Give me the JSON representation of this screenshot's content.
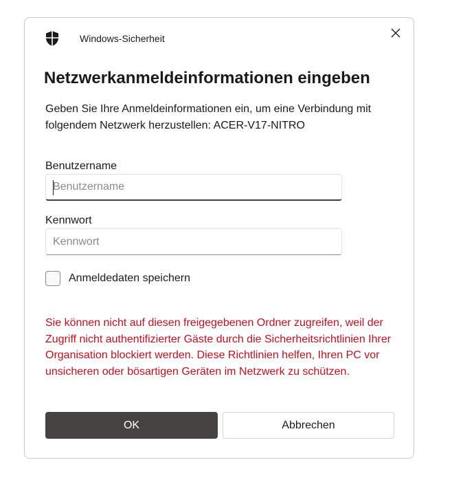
{
  "titlebar": {
    "title": "Windows-Sicherheit",
    "icon": "shield-icon",
    "close_icon": "close-icon"
  },
  "dialog": {
    "heading": "Netzwerkanmeldeinformationen eingeben",
    "description": "Geben Sie Ihre Anmeldeinformationen ein, um eine Verbindung mit folgendem Netzwerk herzustellen: ACER-V17-NITRO"
  },
  "form": {
    "username": {
      "label": "Benutzername",
      "value": "",
      "placeholder": "Benutzername"
    },
    "password": {
      "label": "Kennwort",
      "value": "",
      "placeholder": "Kennwort"
    },
    "remember": {
      "label": "Anmeldedaten speichern",
      "checked": false
    }
  },
  "error": {
    "message": "Sie können nicht auf diesen freigegebenen Ordner zugreifen, weil der Zugriff nicht authentifizierter Gäste durch die Sicherheitsrichtlinien Ihrer Organisation blockiert werden. Diese Richtlinien helfen, Ihren PC vor unsicheren oder bösartigen Geräten im Netzwerk zu schützen.",
    "color": "#c50f1f"
  },
  "buttons": {
    "ok_label": "OK",
    "cancel_label": "Abbrechen",
    "primary_color": "#464343"
  }
}
